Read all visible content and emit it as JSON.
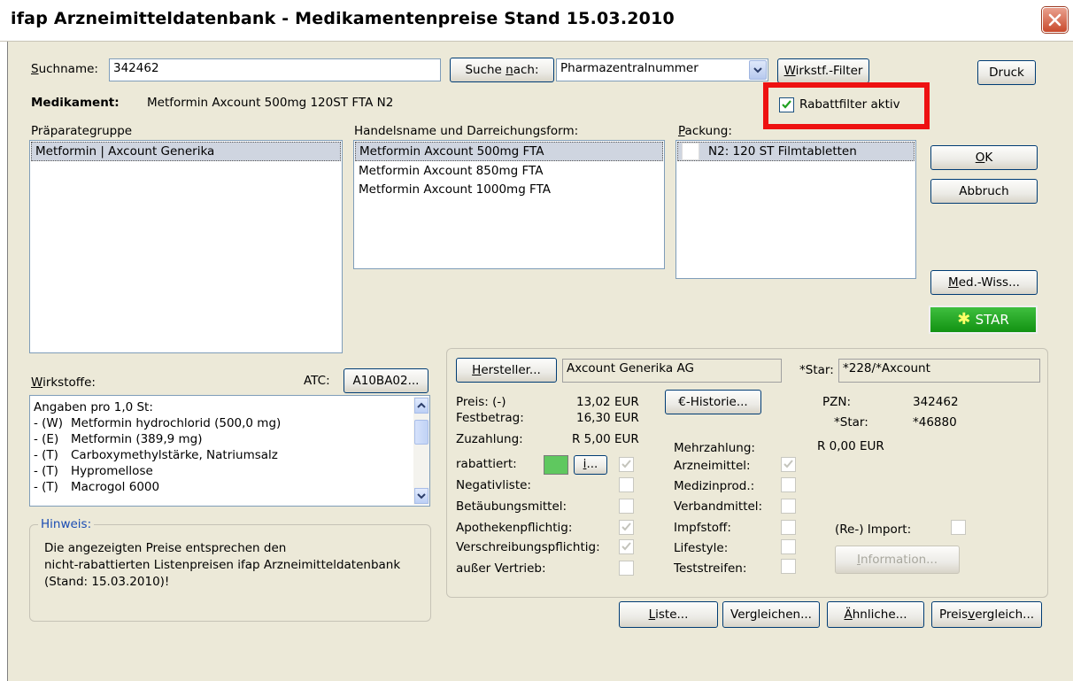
{
  "window": {
    "title": "ifap Arzneimitteldatenbank  -  Medikamentenpreise Stand 15.03.2010"
  },
  "search": {
    "label": "Suchname:",
    "value": "342462",
    "search_by_button": "Suche nach:",
    "search_by_value": "Pharmazentralnummer",
    "wirkstoff_filter_button": "Wirkstf.-Filter",
    "print_button": "Druck"
  },
  "medikament": {
    "label": "Medikament:",
    "value": "Metformin Axcount 500mg 120ST FTA N2"
  },
  "rabattfilter": {
    "label": "Rabattfilter aktiv",
    "checked": true
  },
  "praeparategruppe": {
    "label": "Präparategruppe",
    "items": [
      "Metformin | Axcount Generika"
    ]
  },
  "handelsname": {
    "label": "Handelsname und Darreichungsform:",
    "items": [
      "Metformin Axcount 500mg FTA",
      "Metformin Axcount 850mg FTA",
      "Metformin Axcount 1000mg FTA"
    ]
  },
  "packung": {
    "label": "Packung:",
    "items": [
      "N2: 120 ST Filmtabletten"
    ]
  },
  "buttons": {
    "ok": "OK",
    "abbruch": "Abbruch",
    "med_wiss": "Med.-Wiss...",
    "star": "STAR",
    "liste": "Liste...",
    "vergleichen": "Vergleichen...",
    "aehnliche": "Ähnliche...",
    "preisvergleich": "Preisvergleich..."
  },
  "wirkstoffe": {
    "label": "Wirkstoffe:",
    "atc_label": "ATC:",
    "atc_value": "A10BA02...",
    "header": "Angaben pro 1,0 St:",
    "rows": [
      {
        "code": "- (W)",
        "name": "Metformin hydrochlorid (500,0 mg)"
      },
      {
        "code": "- (E)",
        "name": "Metformin (389,9 mg)"
      },
      {
        "code": "- (T)",
        "name": "Carboxymethylstärke, Natriumsalz"
      },
      {
        "code": "- (T)",
        "name": "Hypromellose"
      },
      {
        "code": "- (T)",
        "name": "Macrogol 6000"
      }
    ]
  },
  "hinweis": {
    "label": "Hinweis:",
    "lines": [
      "Die angezeigten Preise entsprechen den",
      "nicht-rabattierten Listenpreisen ifap Arzneimitteldatenbank",
      "(Stand: 15.03.2010)!"
    ]
  },
  "details": {
    "hersteller_button": "Hersteller...",
    "hersteller_value": "Axcount Generika AG",
    "star_label": "*Star:",
    "star_value": "*228/*Axcount",
    "preis_label": "Preis: (-)",
    "preis_value": "13,02 EUR",
    "historie_button": "€-Historie...",
    "festbetrag_label": "Festbetrag:",
    "festbetrag_value": "16,30 EUR",
    "zuzahlung_label": "Zuzahlung:",
    "zuzahlung_value": "R 5,00 EUR",
    "mehrzahlung_label": "Mehrzahlung:",
    "mehrzahlung_value": "R 0,00 EUR",
    "pzn_label": "PZN:",
    "pzn_value": "342462",
    "star2_label": "*Star:",
    "star2_value": "*46880",
    "info_button": "i...",
    "information_button": "Information...",
    "rabattiert_color": "#5fc85f"
  },
  "flags_left": [
    {
      "label": "rabattiert:",
      "checked": true
    },
    {
      "label": "Negativliste:",
      "checked": false
    },
    {
      "label": "Betäubungsmittel:",
      "checked": false
    },
    {
      "label": "Apothekenpflichtig:",
      "checked": true
    },
    {
      "label": "Verschreibungspflichtig:",
      "checked": true
    },
    {
      "label": "außer Vertrieb:",
      "checked": false
    }
  ],
  "flags_right": [
    {
      "label": "Arzneimittel:",
      "checked": true
    },
    {
      "label": "Medizinprod.:",
      "checked": false
    },
    {
      "label": "Verbandmittel:",
      "checked": false
    },
    {
      "label": "Impfstoff:",
      "checked": false
    },
    {
      "label": "Lifestyle:",
      "checked": false
    },
    {
      "label": "Teststreifen:",
      "checked": false
    }
  ],
  "reimport": {
    "label": "(Re-) Import:",
    "checked": false
  },
  "colors": {
    "highlight_box": "#ee1111",
    "star_green": "#1e9a1e",
    "window_bg": "#ece9d8"
  }
}
